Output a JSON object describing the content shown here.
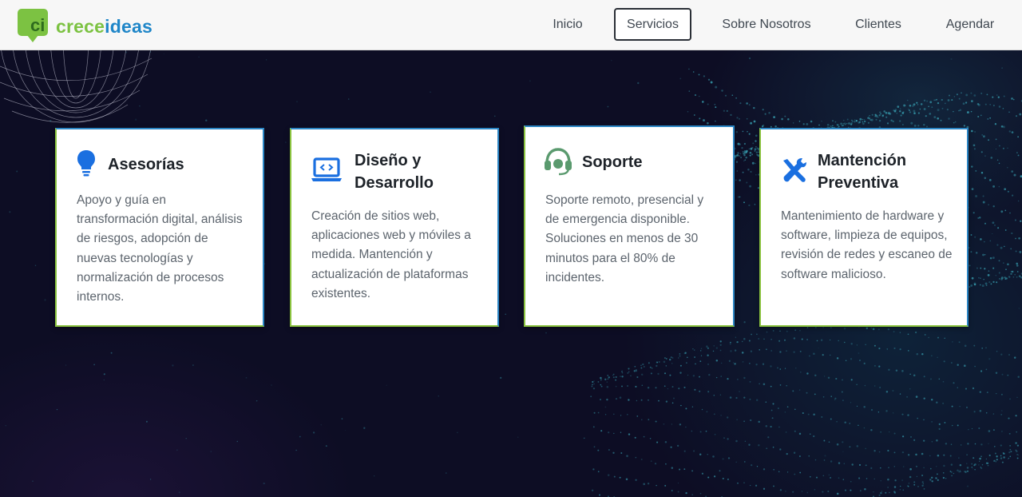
{
  "brand": {
    "part1": "crece",
    "part2": "ideas",
    "glyph": "ci"
  },
  "nav": {
    "items": [
      {
        "label": "Inicio"
      },
      {
        "label": "Servicios"
      },
      {
        "label": "Sobre Nosotros"
      },
      {
        "label": "Clientes"
      },
      {
        "label": "Agendar"
      }
    ],
    "active_index": 1
  },
  "services": [
    {
      "icon": "lightbulb-icon",
      "title": "Asesorías",
      "description": "Apoyo y guía en transformación digital, análisis de riesgos, adopción de nuevas tecnologías y normalización de procesos internos."
    },
    {
      "icon": "laptop-code-icon",
      "title": "Diseño y Desarrollo",
      "description": "Creación de sitios web, aplicaciones web y móviles a medida. Mantención y actualización de plataformas existentes."
    },
    {
      "icon": "headset-icon",
      "title": "Soporte",
      "description": "Soporte remoto, presencial y de emergencia disponible. Soluciones en menos de 30 minutos para el 80% de incidentes."
    },
    {
      "icon": "tools-icon",
      "title": "Mantención Preventiva",
      "description": "Mantenimiento de hardware y software, limpieza de equipos, revisión de redes y escaneo de software malicioso."
    }
  ],
  "colors": {
    "brand_green": "#7cc242",
    "brand_blue": "#1f86c8",
    "icon_blue": "#1a6fe0",
    "icon_green": "#5a9a6e",
    "hero_bg": "#0d0d24"
  }
}
